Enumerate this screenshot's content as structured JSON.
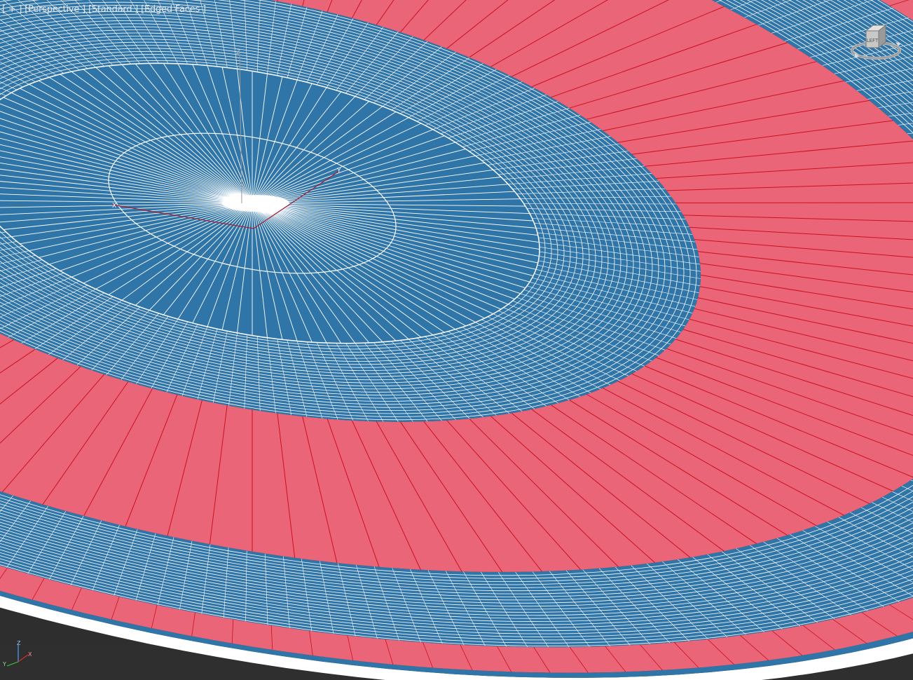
{
  "viewport": {
    "label_plus": "[ + ]",
    "label_view": "[Perspective ]",
    "label_shading": "[Standard ]",
    "label_edges": "[Edged Faces ]",
    "viewcube_face": "LEFT",
    "axis_z": "Z",
    "axis_x": "X",
    "axis_y": "Y"
  },
  "colors": {
    "background": "#2b2b2b",
    "blue_face": "#2f75a8",
    "red_face": "#ea6578",
    "wire_white": "#ffffff",
    "wire_red": "#cc1020"
  },
  "icons": [
    "viewcube-icon",
    "axis-tripod-icon"
  ]
}
